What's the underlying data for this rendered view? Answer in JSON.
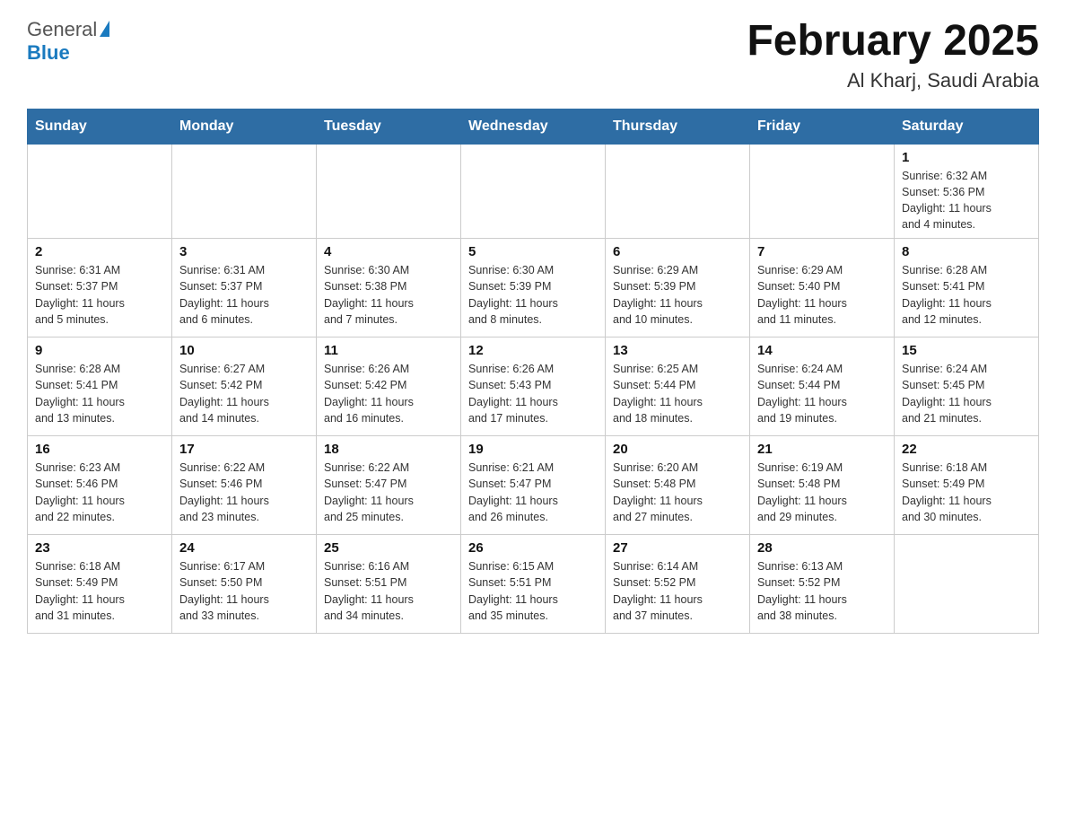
{
  "header": {
    "logo_general": "General",
    "logo_blue": "Blue",
    "title": "February 2025",
    "subtitle": "Al Kharj, Saudi Arabia"
  },
  "days_of_week": [
    "Sunday",
    "Monday",
    "Tuesday",
    "Wednesday",
    "Thursday",
    "Friday",
    "Saturday"
  ],
  "weeks": [
    {
      "days": [
        {
          "number": "",
          "info": "",
          "empty": true
        },
        {
          "number": "",
          "info": "",
          "empty": true
        },
        {
          "number": "",
          "info": "",
          "empty": true
        },
        {
          "number": "",
          "info": "",
          "empty": true
        },
        {
          "number": "",
          "info": "",
          "empty": true
        },
        {
          "number": "",
          "info": "",
          "empty": true
        },
        {
          "number": "1",
          "info": "Sunrise: 6:32 AM\nSunset: 5:36 PM\nDaylight: 11 hours\nand 4 minutes.",
          "empty": false
        }
      ]
    },
    {
      "days": [
        {
          "number": "2",
          "info": "Sunrise: 6:31 AM\nSunset: 5:37 PM\nDaylight: 11 hours\nand 5 minutes.",
          "empty": false
        },
        {
          "number": "3",
          "info": "Sunrise: 6:31 AM\nSunset: 5:37 PM\nDaylight: 11 hours\nand 6 minutes.",
          "empty": false
        },
        {
          "number": "4",
          "info": "Sunrise: 6:30 AM\nSunset: 5:38 PM\nDaylight: 11 hours\nand 7 minutes.",
          "empty": false
        },
        {
          "number": "5",
          "info": "Sunrise: 6:30 AM\nSunset: 5:39 PM\nDaylight: 11 hours\nand 8 minutes.",
          "empty": false
        },
        {
          "number": "6",
          "info": "Sunrise: 6:29 AM\nSunset: 5:39 PM\nDaylight: 11 hours\nand 10 minutes.",
          "empty": false
        },
        {
          "number": "7",
          "info": "Sunrise: 6:29 AM\nSunset: 5:40 PM\nDaylight: 11 hours\nand 11 minutes.",
          "empty": false
        },
        {
          "number": "8",
          "info": "Sunrise: 6:28 AM\nSunset: 5:41 PM\nDaylight: 11 hours\nand 12 minutes.",
          "empty": false
        }
      ]
    },
    {
      "days": [
        {
          "number": "9",
          "info": "Sunrise: 6:28 AM\nSunset: 5:41 PM\nDaylight: 11 hours\nand 13 minutes.",
          "empty": false
        },
        {
          "number": "10",
          "info": "Sunrise: 6:27 AM\nSunset: 5:42 PM\nDaylight: 11 hours\nand 14 minutes.",
          "empty": false
        },
        {
          "number": "11",
          "info": "Sunrise: 6:26 AM\nSunset: 5:42 PM\nDaylight: 11 hours\nand 16 minutes.",
          "empty": false
        },
        {
          "number": "12",
          "info": "Sunrise: 6:26 AM\nSunset: 5:43 PM\nDaylight: 11 hours\nand 17 minutes.",
          "empty": false
        },
        {
          "number": "13",
          "info": "Sunrise: 6:25 AM\nSunset: 5:44 PM\nDaylight: 11 hours\nand 18 minutes.",
          "empty": false
        },
        {
          "number": "14",
          "info": "Sunrise: 6:24 AM\nSunset: 5:44 PM\nDaylight: 11 hours\nand 19 minutes.",
          "empty": false
        },
        {
          "number": "15",
          "info": "Sunrise: 6:24 AM\nSunset: 5:45 PM\nDaylight: 11 hours\nand 21 minutes.",
          "empty": false
        }
      ]
    },
    {
      "days": [
        {
          "number": "16",
          "info": "Sunrise: 6:23 AM\nSunset: 5:46 PM\nDaylight: 11 hours\nand 22 minutes.",
          "empty": false
        },
        {
          "number": "17",
          "info": "Sunrise: 6:22 AM\nSunset: 5:46 PM\nDaylight: 11 hours\nand 23 minutes.",
          "empty": false
        },
        {
          "number": "18",
          "info": "Sunrise: 6:22 AM\nSunset: 5:47 PM\nDaylight: 11 hours\nand 25 minutes.",
          "empty": false
        },
        {
          "number": "19",
          "info": "Sunrise: 6:21 AM\nSunset: 5:47 PM\nDaylight: 11 hours\nand 26 minutes.",
          "empty": false
        },
        {
          "number": "20",
          "info": "Sunrise: 6:20 AM\nSunset: 5:48 PM\nDaylight: 11 hours\nand 27 minutes.",
          "empty": false
        },
        {
          "number": "21",
          "info": "Sunrise: 6:19 AM\nSunset: 5:48 PM\nDaylight: 11 hours\nand 29 minutes.",
          "empty": false
        },
        {
          "number": "22",
          "info": "Sunrise: 6:18 AM\nSunset: 5:49 PM\nDaylight: 11 hours\nand 30 minutes.",
          "empty": false
        }
      ]
    },
    {
      "days": [
        {
          "number": "23",
          "info": "Sunrise: 6:18 AM\nSunset: 5:49 PM\nDaylight: 11 hours\nand 31 minutes.",
          "empty": false
        },
        {
          "number": "24",
          "info": "Sunrise: 6:17 AM\nSunset: 5:50 PM\nDaylight: 11 hours\nand 33 minutes.",
          "empty": false
        },
        {
          "number": "25",
          "info": "Sunrise: 6:16 AM\nSunset: 5:51 PM\nDaylight: 11 hours\nand 34 minutes.",
          "empty": false
        },
        {
          "number": "26",
          "info": "Sunrise: 6:15 AM\nSunset: 5:51 PM\nDaylight: 11 hours\nand 35 minutes.",
          "empty": false
        },
        {
          "number": "27",
          "info": "Sunrise: 6:14 AM\nSunset: 5:52 PM\nDaylight: 11 hours\nand 37 minutes.",
          "empty": false
        },
        {
          "number": "28",
          "info": "Sunrise: 6:13 AM\nSunset: 5:52 PM\nDaylight: 11 hours\nand 38 minutes.",
          "empty": false
        },
        {
          "number": "",
          "info": "",
          "empty": true
        }
      ]
    }
  ]
}
